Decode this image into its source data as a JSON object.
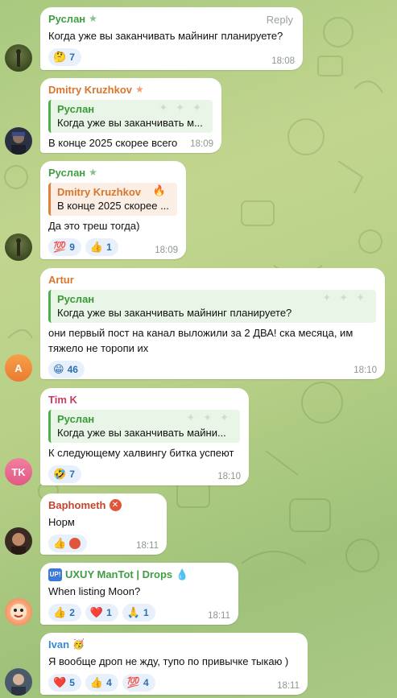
{
  "colors": {
    "ruslan": "#3f9e43",
    "dmitry": "#d8762d",
    "artur": "#d8762d",
    "timk": "#c43b65",
    "baphometh": "#c4452b",
    "uxuy": "#3f9e43",
    "ivan": "#3a8ad6"
  },
  "messages": [
    {
      "sender": "Руслан",
      "reply_label": "Reply",
      "text": "Когда уже вы заканчивать майнинг планируете?",
      "reactions": [
        {
          "emoji": "🤔",
          "count": "7"
        }
      ],
      "time": "18:08"
    },
    {
      "sender": "Dmitry Kruzhkov",
      "quote_name": "Руслан",
      "quote_text": "Когда уже вы заканчивать м...",
      "text": "В конце 2025 скорее всего",
      "time": "18:09"
    },
    {
      "sender": "Руслан",
      "quote_name": "Dmitry Kruzhkov",
      "quote_text": "В конце 2025 скорее ...",
      "text": "Да это треш тогда)",
      "reactions": [
        {
          "emoji": "💯",
          "count": "9"
        },
        {
          "emoji": "👍",
          "count": "1"
        }
      ],
      "time": "18:09"
    },
    {
      "sender": "Artur",
      "quote_name": "Руслан",
      "quote_text": "Когда уже вы заканчивать майнинг планируете?",
      "text": "они первый пост на канал выложили за 2 ДВА! ска месяца, им тяжело не торопи их",
      "reactions": [
        {
          "emoji": "😁",
          "count": "46"
        }
      ],
      "time": "18:10",
      "avatar_letter": "A"
    },
    {
      "sender": "Tim K",
      "quote_name": "Руслан",
      "quote_text": "Когда уже вы заканчивать майни...",
      "text": "К следующему халвингу битка успеют",
      "reactions": [
        {
          "emoji": "🤣",
          "count": "7"
        }
      ],
      "time": "18:10",
      "avatar_letter": "TK"
    },
    {
      "sender": "Baphometh",
      "text": "Норм",
      "reactions": [
        {
          "emoji": "👍",
          "count": ""
        }
      ],
      "time": "18:11"
    },
    {
      "sender": "UXUY ManTot | Drops",
      "badge": "UP!",
      "text": "When listing Moon?",
      "reactions": [
        {
          "emoji": "👍",
          "count": "2"
        },
        {
          "emoji": "❤️",
          "count": "1"
        },
        {
          "emoji": "🙏",
          "count": "1"
        }
      ],
      "time": "18:11"
    },
    {
      "sender": "Ivan",
      "text": "Я вообще дроп не жду, тупо по привычке тыкаю )",
      "reactions": [
        {
          "emoji": "❤️",
          "count": "5"
        },
        {
          "emoji": "👍",
          "count": "4"
        },
        {
          "emoji": "💯",
          "count": "4"
        }
      ],
      "time": "18:11"
    }
  ]
}
